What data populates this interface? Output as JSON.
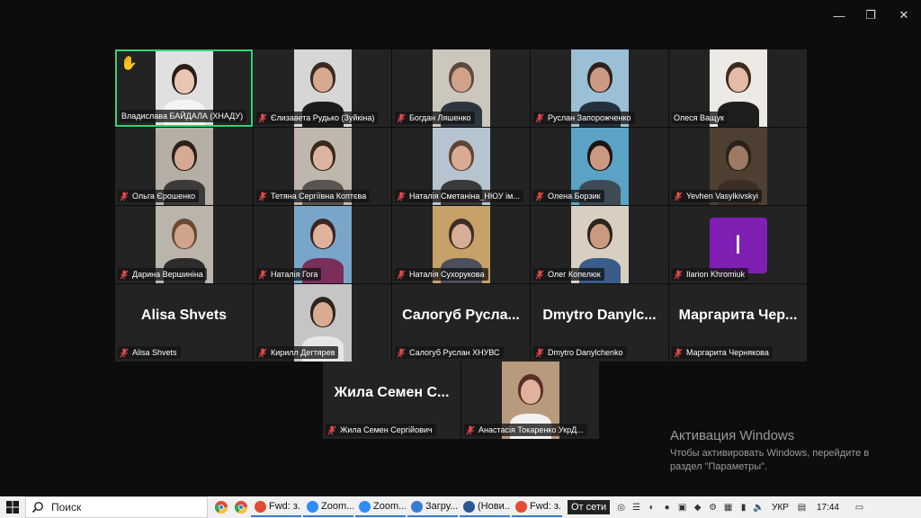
{
  "window": {
    "minimize": "—",
    "maximize": "❐",
    "close": "✕"
  },
  "participants": [
    {
      "name": "Владислава БАЙДАЛА (ХНАДУ)",
      "raised_hand": "✋",
      "muted": false,
      "skin": "#e9c6b3",
      "hair": "#2a1d17",
      "shirt": "#f3f3f3",
      "bg": "#e0e0e0"
    },
    {
      "name": "Єлизавета Рудько (Зуйкіна)",
      "muted": true,
      "skin": "#d7a98f",
      "hair": "#3a2a21",
      "shirt": "#1c1c1c",
      "bg": "#d6d6d6"
    },
    {
      "name": "Богдан Ляшенко",
      "muted": true,
      "skin": "#d1a28a",
      "hair": "#5c4a3e",
      "shirt": "#2d3640",
      "bg": "#ccc7bc"
    },
    {
      "name": "Руслан Запорожченко",
      "muted": true,
      "skin": "#c99a84",
      "hair": "#2b221d",
      "shirt": "#25303c",
      "bg": "#9bc0d6"
    },
    {
      "name": "Олеся Ващук",
      "muted": false,
      "skin": "#e4bba6",
      "hair": "#3b2a20",
      "shirt": "#1e1e1e",
      "bg": "#ede9e4"
    },
    {
      "name": "Ольга Єрошенко",
      "muted": true,
      "skin": "#d6a993",
      "hair": "#2c211a",
      "shirt": "#3c3a3a",
      "bg": "#b5aea5"
    },
    {
      "name": "Тетяна Сергіївна Коптєва",
      "muted": true,
      "skin": "#dcb39e",
      "hair": "#3a281d",
      "shirt": "#5a5451",
      "bg": "#bfb7ae"
    },
    {
      "name": "Наталія Сметаніна_НЮУ ім...",
      "muted": true,
      "skin": "#d9ab93",
      "hair": "#5e4634",
      "shirt": "#3a3a3a",
      "bg": "#b6c4cf"
    },
    {
      "name": "Олена Борзик",
      "muted": true,
      "skin": "#c99a81",
      "hair": "#1c1512",
      "shirt": "#3e4b57",
      "bg": "#5aa3c4"
    },
    {
      "name": "Yevhen Vasylkivskyi",
      "muted": true,
      "skin": "#9d7a62",
      "hair": "#2a211b",
      "shirt": "#3a2e26",
      "bg": "#4e3f33"
    },
    {
      "name": "Дарина Вершиніна",
      "muted": true,
      "skin": "#cfa48a",
      "hair": "#6a4a33",
      "shirt": "#2c2c2c",
      "bg": "#bab4ab"
    },
    {
      "name": "Наталія Гога",
      "muted": true,
      "skin": "#e0b29c",
      "hair": "#3b2620",
      "shirt": "#7a2f5a",
      "bg": "#78a5c8"
    },
    {
      "name": "Наталія Сухорукова",
      "muted": true,
      "skin": "#d7ad97",
      "hair": "#3f2e28",
      "shirt": "#4a4f5a",
      "bg": "#c7a167"
    },
    {
      "name": "Олег Копелюк",
      "muted": true,
      "skin": "#c99a80",
      "hair": "#2b241f",
      "shirt": "#3a5c8a",
      "bg": "#d9cfc1"
    },
    {
      "name": "Ilarion Khromiuk",
      "muted": true,
      "avatar_letter": "I",
      "avatar_color": "#7f1fb4"
    },
    {
      "name": "Alisa Shvets",
      "muted": true,
      "display_name": "Alisa Shvets"
    },
    {
      "name": "Кирилл Дегтярев",
      "muted": true,
      "skin": "#d9ab90",
      "hair": "#2d241f",
      "shirt": "#e6e6e6",
      "bg": "#c5c5c5"
    },
    {
      "name": "Салогуб Руслан ХНУВС",
      "muted": true,
      "display_name": "Салогуб Русла..."
    },
    {
      "name": "Dmytro Danylchenko",
      "muted": true,
      "display_name": "Dmytro Danylc..."
    },
    {
      "name": "Маргарита Чернякова",
      "muted": true,
      "display_name": "Маргарита Чер..."
    }
  ],
  "last_row": [
    {
      "name": "Жила Семен Сергійович",
      "muted": true,
      "display_name": "Жила Семен С..."
    },
    {
      "name": "Анастасія Токаренко УкрД...",
      "muted": true,
      "skin": "#e0b29e",
      "hair": "#5a2d25",
      "shirt": "#f2f2f2",
      "bg": "#b89a7c"
    }
  ],
  "activation": {
    "title": "Активация Windows",
    "body": "Чтобы активировать Windows, перейдите в раздел \"Параметры\"."
  },
  "taskbar": {
    "search_label": "Поиск",
    "apps": [
      {
        "label": "Fwd: з...",
        "color": "#e34b32"
      },
      {
        "label": "Zoom...",
        "color": "#2d8cff"
      },
      {
        "label": "Zoom...",
        "color": "#2d8cff"
      },
      {
        "label": "Загру...",
        "color": "#3a7bd5"
      },
      {
        "label": "(Нови...",
        "color": "#2b5797"
      },
      {
        "label": "Fwd: з...",
        "color": "#e34b32"
      }
    ],
    "offline_label": "От сети",
    "lang": "УКР",
    "time": "17:44"
  }
}
